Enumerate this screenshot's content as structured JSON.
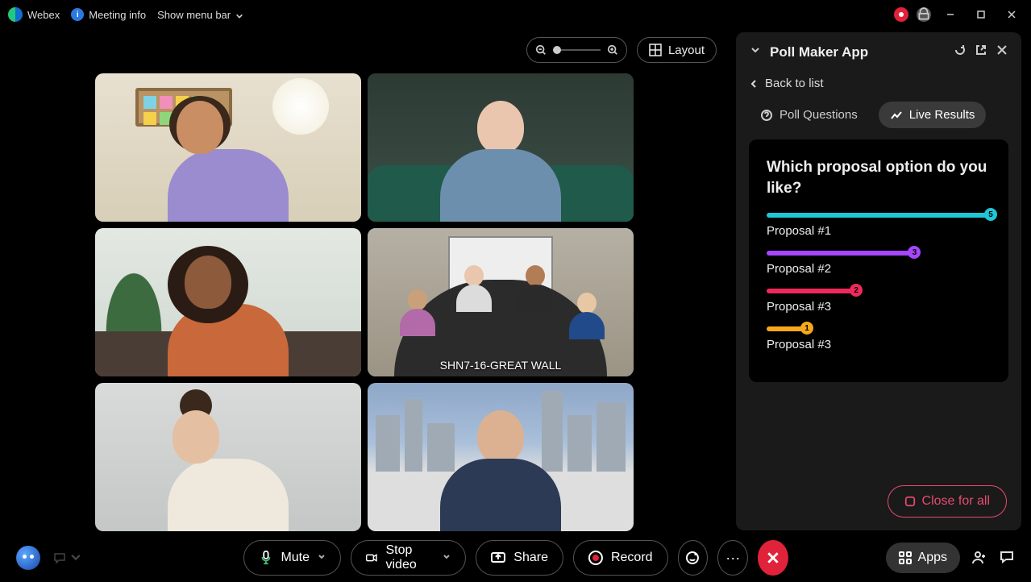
{
  "topbar": {
    "app_name": "Webex",
    "meeting_info": "Meeting info",
    "show_menu": "Show menu bar"
  },
  "layout_controls": {
    "layout_label": "Layout"
  },
  "tiles": {
    "active_label": "SHN7-16-GREAT WALL"
  },
  "panel": {
    "title": "Poll Maker App",
    "back": "Back to list",
    "tab_questions": "Poll Questions",
    "tab_results": "Live Results",
    "question": "Which proposal option do you like?",
    "options": [
      {
        "label": "Proposal #1",
        "count": "5",
        "pct": 100,
        "color": "#1fc6d6"
      },
      {
        "label": "Proposal #2",
        "count": "3",
        "pct": 66,
        "color": "#a646ff"
      },
      {
        "label": "Proposal #3",
        "count": "2",
        "pct": 40,
        "color": "#ef2a5b"
      },
      {
        "label": "Proposal #3",
        "count": "1",
        "pct": 18,
        "color": "#f5a81c"
      }
    ],
    "close_all": "Close for all"
  },
  "controls": {
    "mute": "Mute",
    "stop_video": "Stop video",
    "share": "Share",
    "record": "Record",
    "apps": "Apps"
  }
}
